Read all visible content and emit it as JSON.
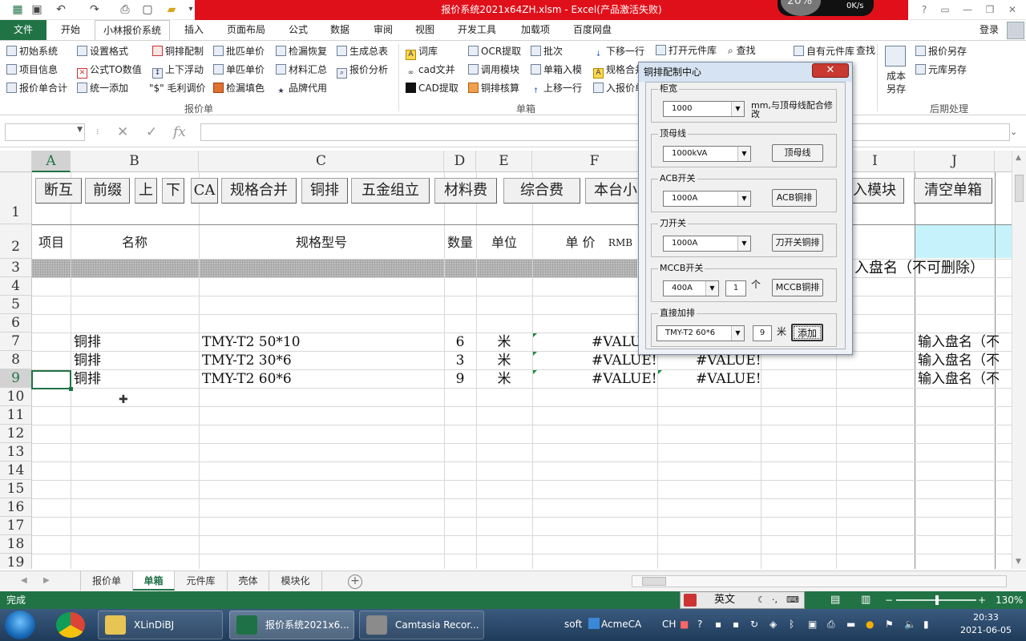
{
  "window": {
    "title": "报价系统2021x64ZH.xlsm - Excel(产品激活失败)",
    "net_percent": "20%",
    "net_speed": "0K/s"
  },
  "ribbon": {
    "tabs": [
      "文件",
      "开始",
      "小林报价系统",
      "插入",
      "页面布局",
      "公式",
      "数据",
      "审阅",
      "视图",
      "开发工具",
      "加载项",
      "百度网盘"
    ],
    "login": "登录",
    "groups": {
      "g1_label": "报价单",
      "g2_label": "单箱",
      "g3_label": "后期处理"
    },
    "items": {
      "init_system": "初始系统",
      "project_info": "项目信息",
      "quote_total": "报价单合计",
      "set_format": "设置格式",
      "formula_to_value": "公式TO数值",
      "unified_add": "统一添加",
      "copper_config": "铜排配制",
      "float_up_down": "上下浮动",
      "margin_adjust": "\"$\" 毛利调价",
      "batch_match_price": "批匹单价",
      "single_match_price": "单匹单价",
      "check_fill_color": "检漏填色",
      "check_restore": "检漏恢复",
      "material_summary": "材料汇总",
      "brand_substitute": "品牌代用",
      "generate_summary": "生成总表",
      "quote_analysis": "报价分析",
      "lexicon": "词库",
      "cad_text": "cad文并",
      "cad_extract": "CAD提取",
      "ocr_extract": "OCR提取",
      "call_module": "调用模块",
      "copper_check": "铜排核算",
      "batch": "批次",
      "single_box_import": "单箱入模",
      "move_up": "上移一行",
      "move_down": "下移一行",
      "spec_merge": "规格合并",
      "import_quote": "入报价单",
      "open_component_lib": "打开元件库",
      "find": "查找",
      "own_component_lib": "自有元件库",
      "cost_save_as": "成本另存",
      "quote_save_as": "报价另存",
      "lib_save_as": "元库另存"
    }
  },
  "formula_bar": {
    "name_box": "",
    "fx": "fx",
    "content": ""
  },
  "sheet": {
    "columns": [
      "A",
      "B",
      "C",
      "D",
      "E",
      "F",
      "G",
      "H",
      "I",
      "J"
    ],
    "rows": [
      "1",
      "2",
      "3",
      "4",
      "5",
      "6",
      "7",
      "8",
      "9",
      "10",
      "11",
      "12",
      "13",
      "14",
      "15",
      "16",
      "17",
      "18",
      "19"
    ],
    "macro_buttons": [
      "断互",
      "前缀",
      "上",
      "下",
      "CA",
      "规格合并",
      "铜排",
      "五金组立",
      "材料费",
      "综合费",
      "本台小",
      "入模块",
      "清空单箱"
    ],
    "header_row": {
      "item": "项目",
      "name": "名称",
      "spec": "规格型号",
      "qty": "数量",
      "unit": "单位",
      "price": "单 价",
      "currency": "RMB"
    },
    "row3_note": "入盘名（不可删除）",
    "data_rows": [
      {
        "name": "铜排",
        "spec": "TMY-T2  50*10",
        "qty": "6",
        "unit": "米",
        "price": "#VALUE",
        "total": "",
        "note": "输入盘名（不"
      },
      {
        "name": "铜排",
        "spec": "TMY-T2  30*6",
        "qty": "3",
        "unit": "米",
        "price": "#VALUE!",
        "total": "#VALUE!",
        "note": "输入盘名（不"
      },
      {
        "name": "铜排",
        "spec": "TMY-T2  60*6",
        "qty": "9",
        "unit": "米",
        "price": "#VALUE!",
        "total": "#VALUE!",
        "note": "输入盘名（不"
      }
    ]
  },
  "dialog": {
    "title": "铜排配制中心",
    "close": "✕",
    "cabinet_width": {
      "legend": "柜宽",
      "value": "1000",
      "note": "mm,与顶母线配合修改"
    },
    "top_busbar": {
      "legend": "顶母线",
      "value": "1000kVA",
      "button": "顶母线"
    },
    "acb": {
      "legend": "ACB开关",
      "value": "1000A",
      "button": "ACB铜排"
    },
    "knife_switch": {
      "legend": "刀开关",
      "value": "1000A",
      "button": "刀开关铜排"
    },
    "mccb": {
      "legend": "MCCB开关",
      "value": "400A",
      "count": "1",
      "count_unit": "个",
      "button": "MCCB铜排"
    },
    "direct_add": {
      "legend": "直接加排",
      "value": "TMY-T2 60*6",
      "length": "9",
      "length_unit": "米",
      "button": "添加"
    }
  },
  "sheet_tabs": {
    "tabs": [
      "报价单",
      "单箱",
      "元件库",
      "壳体",
      "模块化"
    ],
    "active": "单箱"
  },
  "status": {
    "ready": "完成",
    "ime": "英文",
    "zoom": "130%"
  },
  "taskbar": {
    "apps": [
      "XLinDiBJ",
      "报价系统2021x6...",
      "Camtasia Recor..."
    ],
    "tray_soft": "soft",
    "tray_acme": "AcmeCA",
    "tray_lang": "CH",
    "time": "20:33",
    "date": "2021-06-05"
  },
  "colors": {
    "excel_green": "#217346",
    "title_red": "#e0101a",
    "cyan_cell": "#c6f3fb"
  }
}
